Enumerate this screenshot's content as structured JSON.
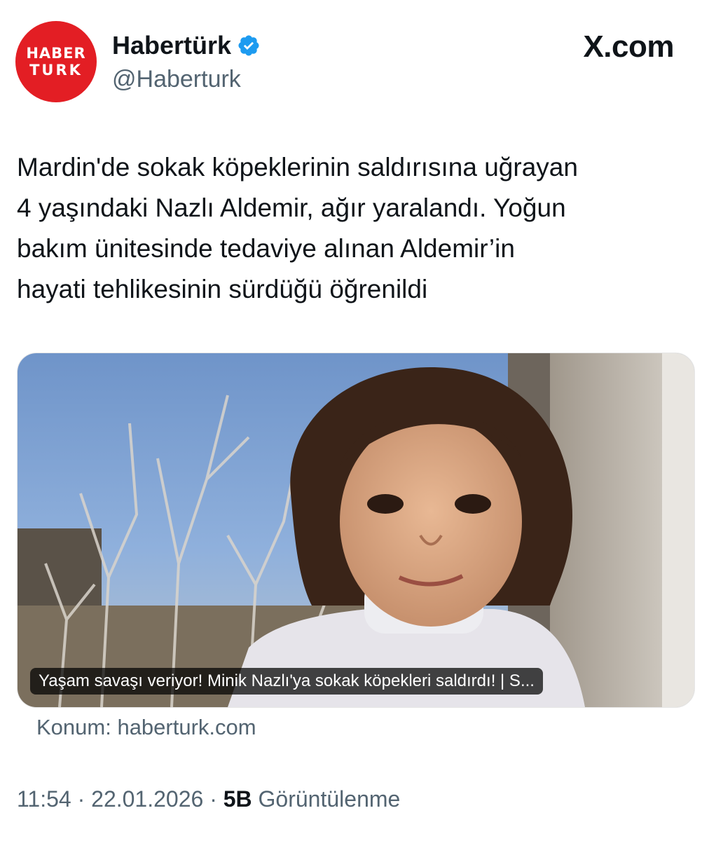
{
  "account": {
    "avatar_line1": "HABER",
    "avatar_line2": "TURK",
    "name": "Habertürk",
    "handle": "@Haberturk"
  },
  "brand": "X.com",
  "tweet": {
    "lines": [
      "Mardin'de sokak köpeklerinin saldırısına uğrayan",
      "4 yaşındaki Nazlı Aldemir, ağır yaralandı. Yoğun",
      "bakım ünitesinde tedaviye alınan Aldemir’in",
      "hayati tehlikesinin sürdüğü öğrenildi"
    ]
  },
  "media": {
    "caption": "Yaşam savaşı veriyor! Minik Nazlı'ya sokak köpekleri saldırdı! | S..."
  },
  "source": "Konum: haberturk.com",
  "meta": {
    "time": "11:54",
    "date": "22.01.2026",
    "views": "5B",
    "views_label": "Görüntülenme"
  },
  "colors": {
    "avatar_bg": "#e31e24",
    "verified": "#1d9bf0",
    "secondary_text": "#536471"
  }
}
